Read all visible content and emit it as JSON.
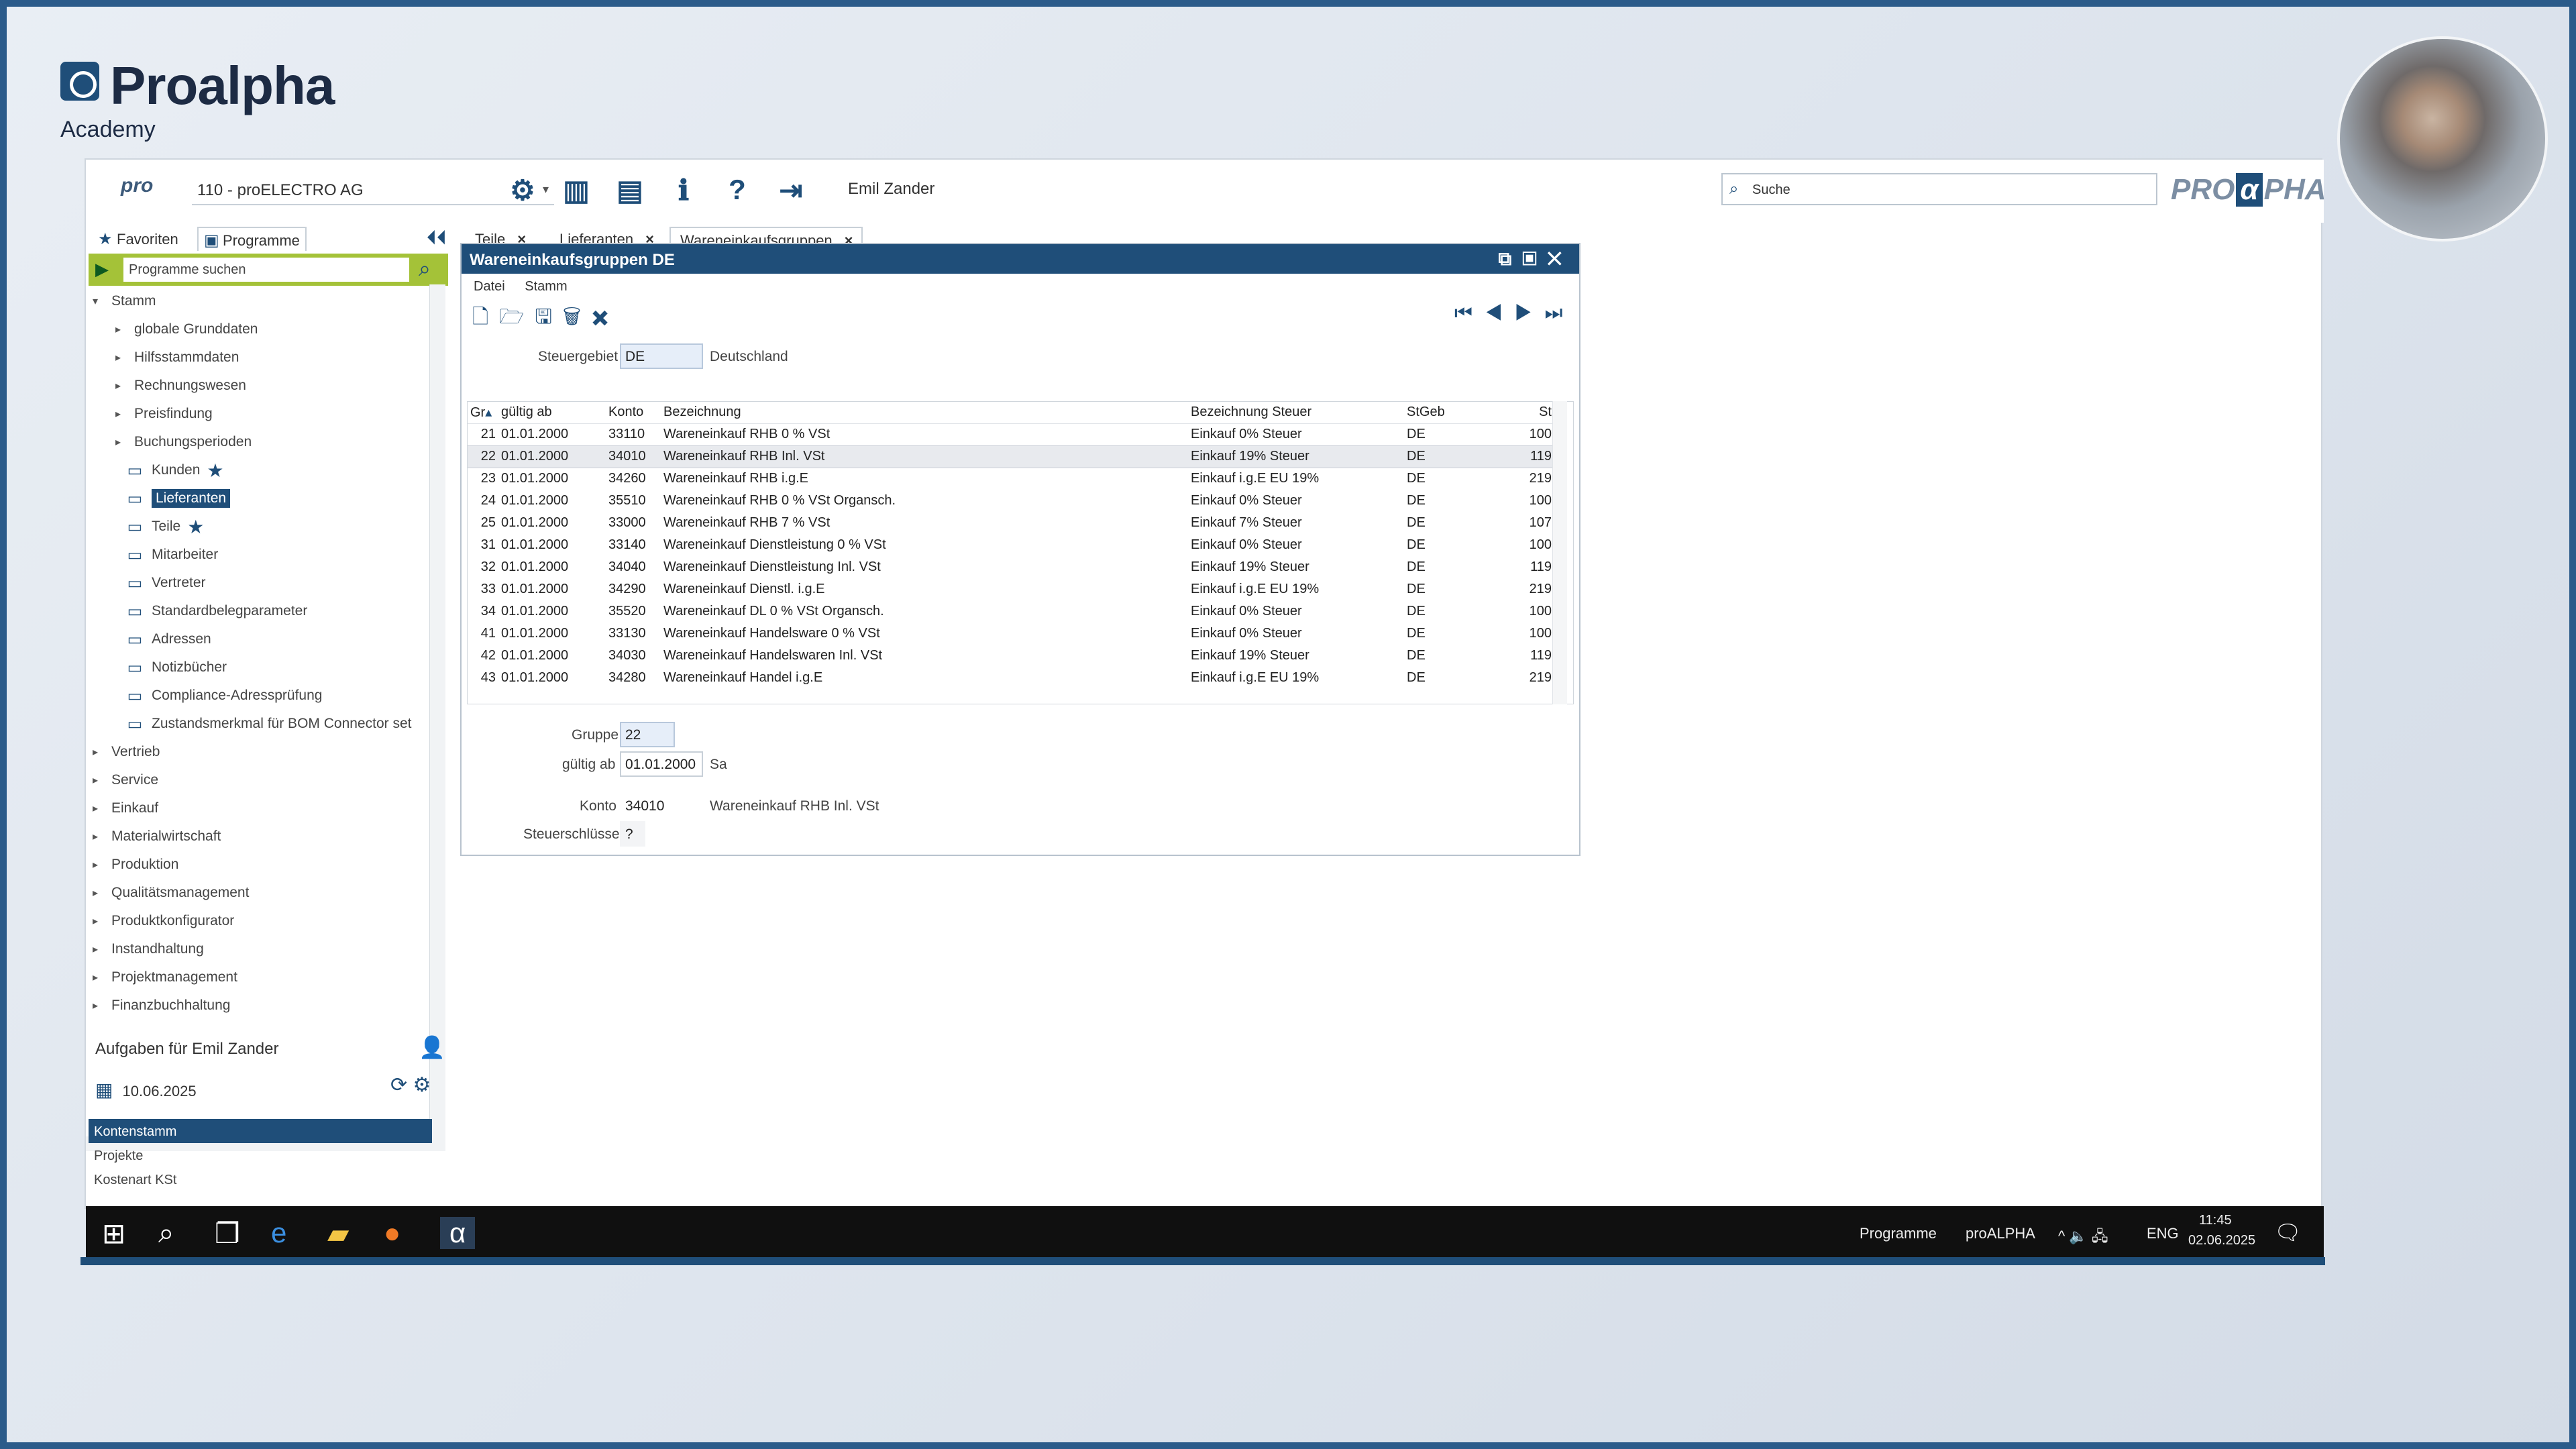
{
  "brand": {
    "name": "Proalpha",
    "subtitle": "Academy"
  },
  "toolbar": {
    "pro_logo": "pro",
    "company": "110 - proELECTRO AG",
    "user": "Emil Zander",
    "search_placeholder": "Suche",
    "logo_left": "PRO",
    "logo_alpha": "α",
    "logo_right": "PHA",
    "icons": [
      "gear-icon",
      "split-view-icon",
      "layout-icon",
      "info-icon",
      "help-icon",
      "logout-icon"
    ]
  },
  "left_panel": {
    "tabs": [
      "Favoriten",
      "Programme"
    ],
    "search_placeholder": "Programme suchen",
    "tree": [
      {
        "label": "Stamm",
        "level": 0,
        "expanded": true
      },
      {
        "label": "globale Grunddaten",
        "level": 1
      },
      {
        "label": "Hilfsstammdaten",
        "level": 1
      },
      {
        "label": "Rechnungswesen",
        "level": 1
      },
      {
        "label": "Preisfindung",
        "level": 1
      },
      {
        "label": "Buchungsperioden",
        "level": 1
      },
      {
        "label": "Kunden",
        "level": 2,
        "star": true
      },
      {
        "label": "Lieferanten",
        "level": 2,
        "selected": true
      },
      {
        "label": "Teile",
        "level": 2,
        "star": true
      },
      {
        "label": "Mitarbeiter",
        "level": 2
      },
      {
        "label": "Vertreter",
        "level": 2
      },
      {
        "label": "Standardbelegparameter",
        "level": 2
      },
      {
        "label": "Adressen",
        "level": 2
      },
      {
        "label": "Notizbücher",
        "level": 2
      },
      {
        "label": "Compliance-Adressprüfung",
        "level": 2
      },
      {
        "label": "Zustandsmerkmal für BOM Connector set",
        "level": 2
      },
      {
        "label": "Vertrieb",
        "level": 0
      },
      {
        "label": "Service",
        "level": 0
      },
      {
        "label": "Einkauf",
        "level": 0
      },
      {
        "label": "Materialwirtschaft",
        "level": 0
      },
      {
        "label": "Produktion",
        "level": 0
      },
      {
        "label": "Qualitätsmanagement",
        "level": 0
      },
      {
        "label": "Produktkonfigurator",
        "level": 0
      },
      {
        "label": "Instandhaltung",
        "level": 0
      },
      {
        "label": "Projektmanagement",
        "level": 0
      },
      {
        "label": "Finanzbuchhaltung",
        "level": 0
      }
    ],
    "tasks_title": "Aufgaben für Emil Zander",
    "tasks_date": "10.06.2025",
    "tasks": [
      "Kontenstamm",
      "Projekte",
      "Kostenart KSt"
    ]
  },
  "doc_tabs": [
    "Teile",
    "Lieferanten",
    "Wareneinkaufsgruppen"
  ],
  "window": {
    "title": "Wareneinkaufsgruppen DE",
    "menu": [
      "Datei",
      "Stamm"
    ],
    "steuergebiet_label": "Steuergebiet",
    "steuergebiet_value": "DE",
    "steuergebiet_name": "Deutschland",
    "columns": [
      "Gr",
      "gültig ab",
      "Konto",
      "Bezeichnung",
      "Bezeichnung Steuer",
      "StGeb",
      "St"
    ],
    "rows": [
      [
        "21",
        "01.01.2000",
        "33110",
        "Wareneinkauf RHB 0 % VSt",
        "Einkauf 0% Steuer",
        "DE",
        "100"
      ],
      [
        "22",
        "01.01.2000",
        "34010",
        "Wareneinkauf RHB Inl. VSt",
        "Einkauf 19% Steuer",
        "DE",
        "119"
      ],
      [
        "23",
        "01.01.2000",
        "34260",
        "Wareneinkauf RHB i.g.E",
        "Einkauf i.g.E EU 19%",
        "DE",
        "219"
      ],
      [
        "24",
        "01.01.2000",
        "35510",
        "Wareneinkauf RHB 0 % VSt Organsch.",
        "Einkauf 0% Steuer",
        "DE",
        "100"
      ],
      [
        "25",
        "01.01.2000",
        "33000",
        "Wareneinkauf RHB 7 % VSt",
        "Einkauf 7% Steuer",
        "DE",
        "107"
      ],
      [
        "31",
        "01.01.2000",
        "33140",
        "Wareneinkauf Dienstleistung 0 % VSt",
        "Einkauf 0% Steuer",
        "DE",
        "100"
      ],
      [
        "32",
        "01.01.2000",
        "34040",
        "Wareneinkauf Dienstleistung Inl. VSt",
        "Einkauf 19% Steuer",
        "DE",
        "119"
      ],
      [
        "33",
        "01.01.2000",
        "34290",
        "Wareneinkauf Dienstl. i.g.E",
        "Einkauf i.g.E EU 19%",
        "DE",
        "219"
      ],
      [
        "34",
        "01.01.2000",
        "35520",
        "Wareneinkauf DL 0 % VSt Organsch.",
        "Einkauf 0% Steuer",
        "DE",
        "100"
      ],
      [
        "41",
        "01.01.2000",
        "33130",
        "Wareneinkauf Handelsware 0 % VSt",
        "Einkauf 0% Steuer",
        "DE",
        "100"
      ],
      [
        "42",
        "01.01.2000",
        "34030",
        "Wareneinkauf Handelswaren Inl. VSt",
        "Einkauf 19% Steuer",
        "DE",
        "119"
      ],
      [
        "43",
        "01.01.2000",
        "34280",
        "Wareneinkauf Handel i.g.E",
        "Einkauf i.g.E EU 19%",
        "DE",
        "219"
      ]
    ],
    "selected_row": 1,
    "detail": {
      "gruppe_label": "Gruppe",
      "gruppe_value": "22",
      "gueltig_label": "gültig ab",
      "gueltig_value": "01.01.2000",
      "weekday": "Sa",
      "konto_label": "Konto",
      "konto_value": "34010",
      "konto_name": "Wareneinkauf RHB Inl. VSt",
      "steuer_label": "Steuerschlüssel",
      "steuer_value": "?"
    }
  },
  "taskbar": {
    "programs_label": "Programme",
    "app_label": "proALPHA",
    "lang": "ENG",
    "time": "11:45",
    "date": "02.06.2025"
  },
  "colors": {
    "accent": "#1f4e79",
    "highlight": "#a4c238"
  }
}
